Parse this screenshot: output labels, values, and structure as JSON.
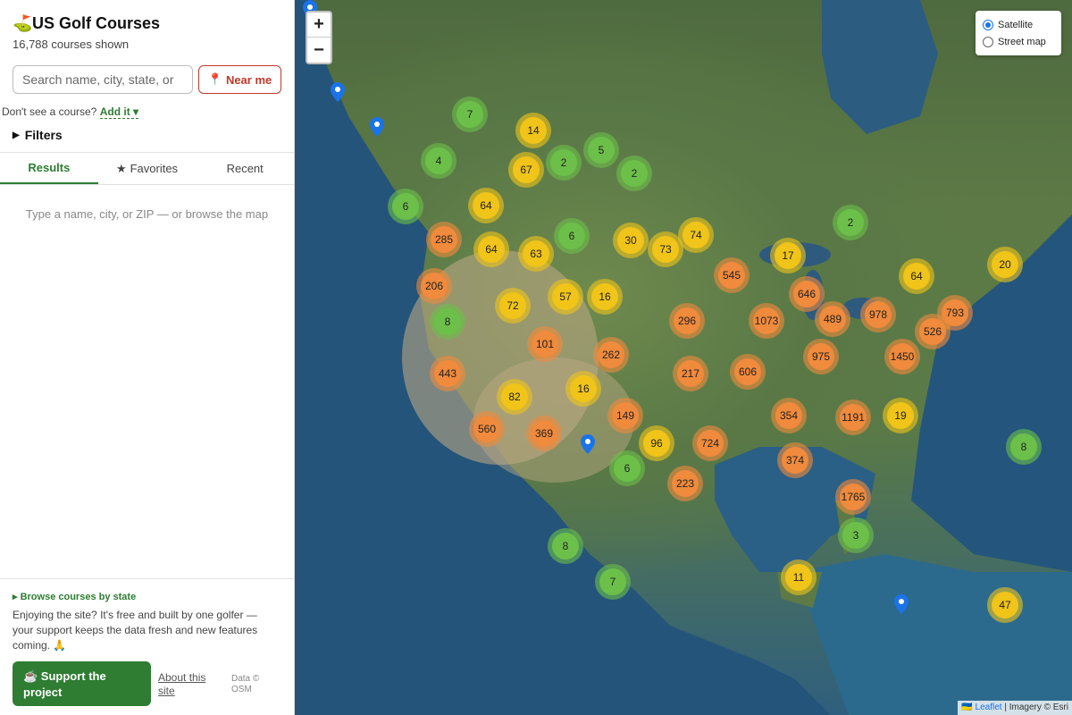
{
  "sidebar": {
    "title": "US Golf Courses",
    "subtitle": "16,788 courses shown",
    "search_placeholder": "Search name, city, state, or",
    "near_me": "Near me",
    "add_prompt": "Don't see a course?",
    "add_link": "Add it ▾",
    "filters": "Filters",
    "tabs": [
      {
        "label": "Results",
        "icon": ""
      },
      {
        "label": "Favorites",
        "icon": "★"
      },
      {
        "label": "Recent",
        "icon": ""
      }
    ],
    "empty_hint": "Type a name, city, or ZIP — or browse the map",
    "browse": "▸ Browse courses by state",
    "support_text": "Enjoying the site? It's free and built by one golfer — your support keeps the data fresh and new features coming. 🙏",
    "support_button": "☕ Support the project",
    "about": "About this site",
    "data_credit": "Data © OSM"
  },
  "map": {
    "zoom_in": "+",
    "zoom_out": "−",
    "layers": [
      "Satellite",
      "Street map"
    ],
    "selected_layer": "Satellite",
    "attribution_leaflet": "Leaflet",
    "attribution_rest": " | Imagery © Esri",
    "colors": {
      "small": "#6cc04a",
      "medium": "#f0c419",
      "large": "#f08a3c",
      "pin": "#1a73e8"
    },
    "clusters": [
      {
        "count": "7"
      },
      {
        "count": "14"
      },
      {
        "count": "4"
      },
      {
        "count": "67"
      },
      {
        "count": "2"
      },
      {
        "count": "5"
      },
      {
        "count": "2"
      },
      {
        "count": "6"
      },
      {
        "count": "64"
      },
      {
        "count": "285"
      },
      {
        "count": "64"
      },
      {
        "count": "63"
      },
      {
        "count": "6"
      },
      {
        "count": "30"
      },
      {
        "count": "73"
      },
      {
        "count": "74"
      },
      {
        "count": "2"
      },
      {
        "count": "17"
      },
      {
        "count": "64"
      },
      {
        "count": "20"
      },
      {
        "count": "206"
      },
      {
        "count": "72"
      },
      {
        "count": "57"
      },
      {
        "count": "16"
      },
      {
        "count": "545"
      },
      {
        "count": "646"
      },
      {
        "count": "8"
      },
      {
        "count": "101"
      },
      {
        "count": "296"
      },
      {
        "count": "1073"
      },
      {
        "count": "489"
      },
      {
        "count": "978"
      },
      {
        "count": "793"
      },
      {
        "count": "526"
      },
      {
        "count": "262"
      },
      {
        "count": "975"
      },
      {
        "count": "1450"
      },
      {
        "count": "443"
      },
      {
        "count": "217"
      },
      {
        "count": "606"
      },
      {
        "count": "16"
      },
      {
        "count": "82"
      },
      {
        "count": "149"
      },
      {
        "count": "354"
      },
      {
        "count": "1191"
      },
      {
        "count": "19"
      },
      {
        "count": "560"
      },
      {
        "count": "369"
      },
      {
        "count": "96"
      },
      {
        "count": "724"
      },
      {
        "count": "8"
      },
      {
        "count": "6"
      },
      {
        "count": "374"
      },
      {
        "count": "223"
      },
      {
        "count": "1765"
      },
      {
        "count": "3"
      },
      {
        "count": "8"
      },
      {
        "count": "11"
      },
      {
        "count": "7"
      },
      {
        "count": "47"
      }
    ]
  }
}
